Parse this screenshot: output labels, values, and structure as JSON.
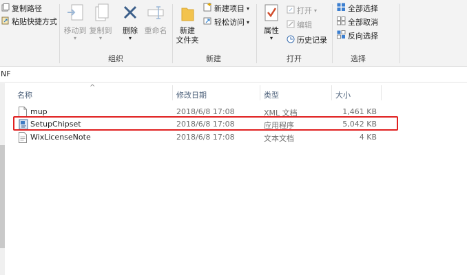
{
  "ribbon": {
    "copy_path": "复制路径",
    "paste_shortcut": "粘贴快捷方式",
    "move_to": "移动到",
    "copy_to": "复制到",
    "delete": "删除",
    "rename": "重命名",
    "group_organize": "组织",
    "new_folder_line1": "新建",
    "new_folder_line2": "文件夹",
    "new_item": "新建项目",
    "easy_access": "轻松访问",
    "group_new": "新建",
    "properties": "属性",
    "open": "打开",
    "edit": "编辑",
    "history": "历史记录",
    "group_open": "打开",
    "select_all": "全部选择",
    "select_none": "全部取消",
    "invert_selection": "反向选择",
    "group_select": "选择"
  },
  "address": {
    "path_fragment": "NF"
  },
  "columns": {
    "name": "名称",
    "date": "修改日期",
    "type": "类型",
    "size": "大小"
  },
  "files": [
    {
      "name": "mup",
      "date": "2018/6/8 17:08",
      "type": "XML 文档",
      "size": "1,461 KB",
      "icon": "document-icon"
    },
    {
      "name": "SetupChipset",
      "date": "2018/6/8 17:08",
      "type": "应用程序",
      "size": "5,042 KB",
      "icon": "installer-icon"
    },
    {
      "name": "WixLicenseNote",
      "date": "2018/6/8 17:08",
      "type": "文本文档",
      "size": "4 KB",
      "icon": "text-file-icon"
    }
  ],
  "colors": {
    "highlight": "#e02020",
    "accent": "#1a73c8"
  }
}
